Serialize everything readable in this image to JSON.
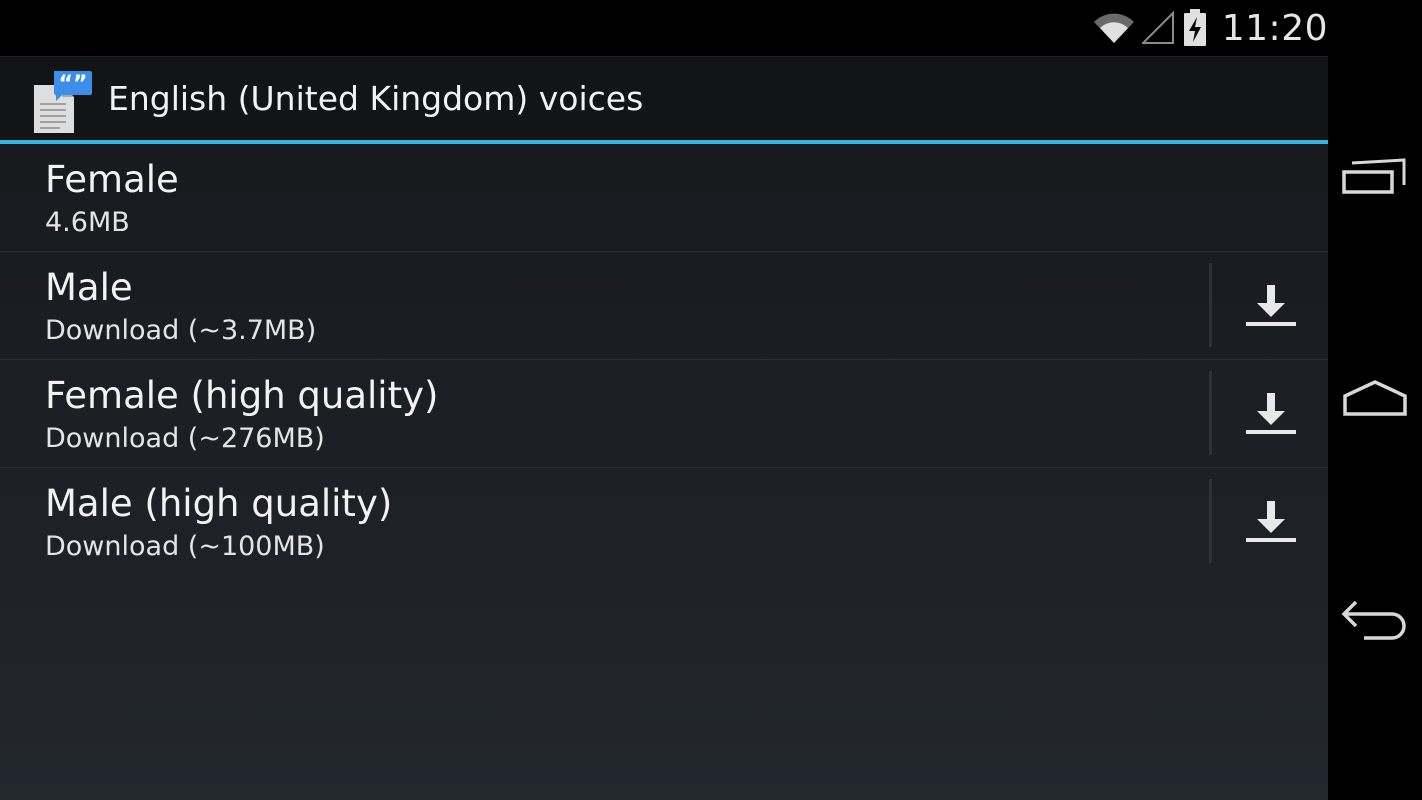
{
  "status_bar": {
    "time": "11:20",
    "icons": [
      "wifi-icon",
      "cell-signal-icon",
      "battery-charging-icon"
    ]
  },
  "action_bar": {
    "app_icon": "tts-voice-icon",
    "title": "English (United Kingdom) voices"
  },
  "colors": {
    "accent": "#33b5e5",
    "background": "#1a1d22",
    "text": "#f2f2f2"
  },
  "voices": [
    {
      "name": "Female",
      "detail": "4.6MB",
      "download_icon": false
    },
    {
      "name": "Male",
      "detail": "Download (~3.7MB)",
      "download_icon": true
    },
    {
      "name": "Female (high quality)",
      "detail": "Download (~276MB)",
      "download_icon": true
    },
    {
      "name": "Male (high quality)",
      "detail": "Download (~100MB)",
      "download_icon": true
    }
  ],
  "nav_bar": {
    "buttons": [
      "recent-apps-icon",
      "home-icon",
      "back-icon"
    ]
  }
}
